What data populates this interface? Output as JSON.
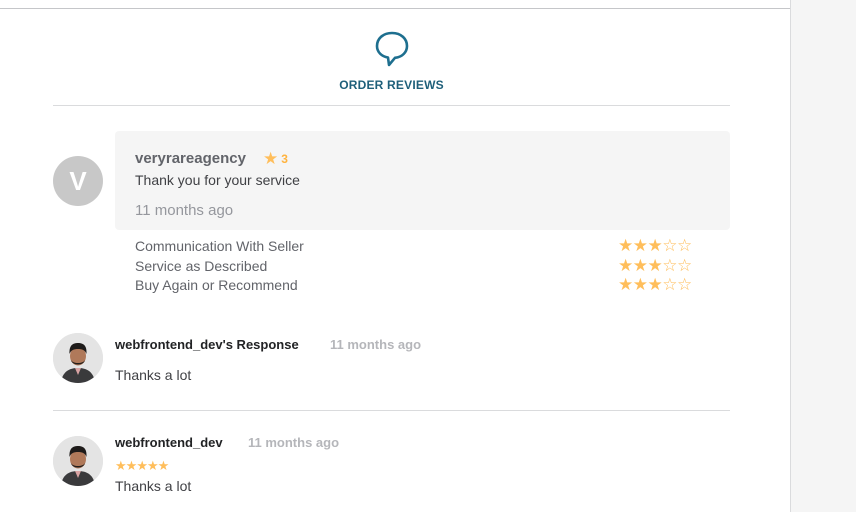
{
  "header": {
    "title": "ORDER REVIEWS",
    "icon": "speech-bubble-icon",
    "accent": "#1e5f7a"
  },
  "review": {
    "avatar_letter": "V",
    "username": "veryrareagency",
    "rating": "3",
    "text": "Thank you for your service",
    "time": "11 months ago"
  },
  "breakdown": [
    {
      "label": "Communication With Seller",
      "stars": 3
    },
    {
      "label": "Service as Described",
      "stars": 3
    },
    {
      "label": "Buy Again or Recommend",
      "stars": 3
    }
  ],
  "response": {
    "title": "webfrontend_dev's Response",
    "time": "11 months ago",
    "text": "Thanks a lot"
  },
  "buyer_review": {
    "username": "webfrontend_dev",
    "time": "11 months ago",
    "stars": 5,
    "text": "Thanks a lot"
  },
  "colors": {
    "star": "#ffbe5b",
    "box_bg": "#f5f5f5"
  }
}
